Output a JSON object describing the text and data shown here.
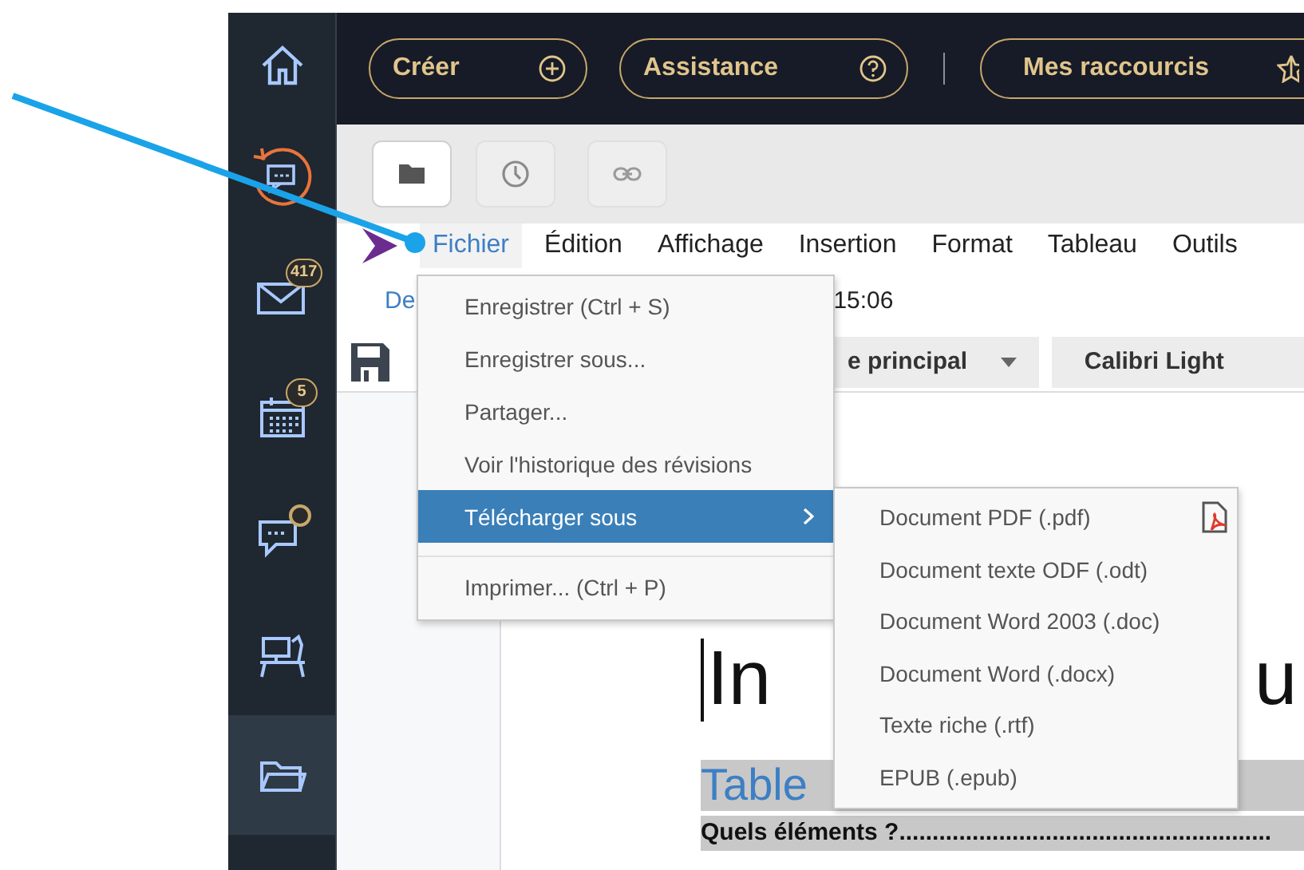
{
  "sidebar": {
    "items": [
      {
        "selected": false
      },
      {
        "selected": false
      },
      {
        "badge": "417",
        "selected": false
      },
      {
        "badge": "5",
        "selected": false
      },
      {
        "dot": true,
        "selected": false
      },
      {
        "selected": false
      },
      {
        "selected": true
      }
    ]
  },
  "top_bar": {
    "buttons": [
      {
        "label": "Créer"
      },
      {
        "label": "Assistance"
      },
      {
        "label": "Mes raccourcis"
      }
    ]
  },
  "toolbar": {
    "buttons": [
      {
        "selected": true
      },
      {
        "selected": false
      },
      {
        "selected": false
      }
    ]
  },
  "menu_bar": {
    "items": [
      {
        "label": "Fichier",
        "selected": true
      },
      {
        "label": "Édition",
        "selected": false
      },
      {
        "label": "Affichage",
        "selected": false
      },
      {
        "label": "Insertion",
        "selected": false
      },
      {
        "label": "Format",
        "selected": false
      },
      {
        "label": "Tableau",
        "selected": false
      },
      {
        "label": "Outils",
        "selected": false
      }
    ]
  },
  "document": {
    "info_start": "De",
    "info_end": "15:06",
    "style_dropdown": "e principal",
    "font_button": "Calibri Light",
    "heading_start": "In",
    "heading_end": "u",
    "toc_title": "Table",
    "toc_entry": "Quels éléments ?........................................................"
  },
  "file_menu": {
    "items": [
      {
        "label": "Enregistrer (Ctrl + S)",
        "selected": false
      },
      {
        "label": "Enregistrer sous...",
        "selected": false
      },
      {
        "label": "Partager...",
        "selected": false
      },
      {
        "label": "Voir l'historique des révisions",
        "selected": false
      },
      {
        "label": "Télécharger sous",
        "submenu": true,
        "selected": true
      },
      {
        "label": "Imprimer... (Ctrl + P)",
        "separator_before": true,
        "selected": false
      }
    ]
  },
  "download_submenu": {
    "items": [
      {
        "label": "Document PDF (.pdf)"
      },
      {
        "label": "Document texte ODF (.odt)"
      },
      {
        "label": "Document Word 2003 (.doc)"
      },
      {
        "label": "Document Word (.docx)"
      },
      {
        "label": "Texte riche (.rtf)"
      },
      {
        "label": "EPUB (.epub)"
      }
    ]
  }
}
